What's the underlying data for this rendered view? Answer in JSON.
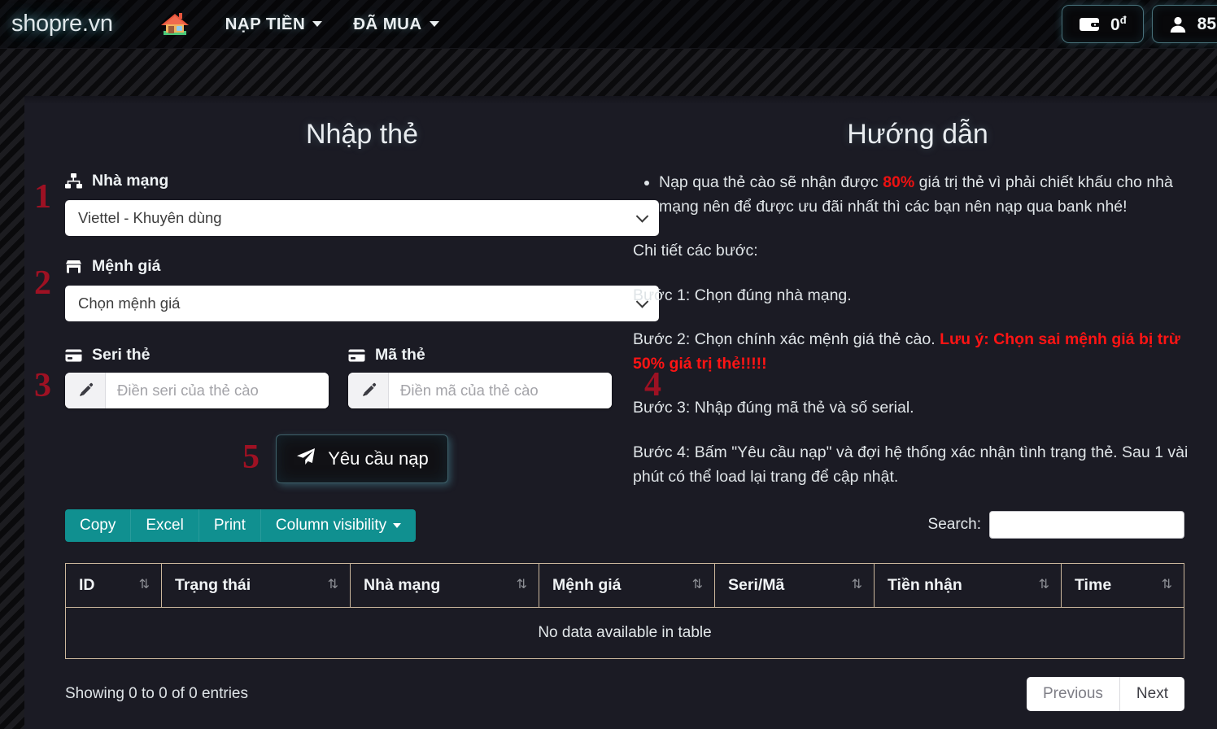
{
  "header": {
    "brand": "shopre.vn",
    "home_icon": "home-icon",
    "nav": [
      {
        "label": "NẠP TIỀN",
        "icon": "chevron-down-icon"
      },
      {
        "label": "ĐÃ MUA",
        "icon": "chevron-down-icon"
      }
    ],
    "wallet": {
      "icon": "wallet-icon",
      "amount": "0",
      "currency": "đ"
    },
    "user": {
      "icon": "user-icon",
      "value": "85"
    }
  },
  "card_form": {
    "title": "Nhập thẻ",
    "network_label": "Nhà mạng",
    "network_icon": "sitemap-icon",
    "network_value": "Viettel - Khuyên dùng",
    "amount_label": "Mệnh giá",
    "amount_icon": "store-icon",
    "amount_value": "Chọn mệnh giá",
    "serial_label": "Seri thẻ",
    "serial_icon": "credit-card-icon",
    "serial_placeholder": "Điền seri của thẻ cào",
    "serial_value": "",
    "code_label": "Mã thẻ",
    "code_icon": "credit-card-icon",
    "code_placeholder": "Điền mã của thẻ cào",
    "code_value": "",
    "input_prefix_icon": "pen-icon",
    "submit_label": "Yêu cầu nạp",
    "submit_icon": "paper-plane-icon",
    "steps": [
      "1",
      "2",
      "3",
      "4",
      "5"
    ]
  },
  "guide": {
    "title": "Hướng dẫn",
    "bullet_pre": "Nạp qua thẻ cào sẽ nhận được ",
    "bullet_highlight": "80%",
    "bullet_post": " giá trị thẻ vì phải chiết khấu cho nhà mạng nên để được ưu đãi nhất thì các bạn nên nạp qua bank nhé!",
    "intro": "Chi tiết các bước:",
    "step1": "Bước 1: Chọn đúng nhà mạng.",
    "step2_pre": "Bước 2: Chọn chính xác mệnh giá thẻ cào. ",
    "step2_warn": "Lưu ý: Chọn sai mệnh giá bị trừ 50% giá trị thẻ!!!!!",
    "step3": "Bước 3: Nhập đúng mã thẻ và số serial.",
    "step4": "Bước 4: Bấm \"Yêu cầu nạp\" và đợi hệ thống xác nhận tình trạng thẻ. Sau 1 vài phút có thể load lại trang để cập nhật."
  },
  "table": {
    "buttons": [
      {
        "label": "Copy"
      },
      {
        "label": "Excel"
      },
      {
        "label": "Print"
      },
      {
        "label": "Column visibility",
        "caret": true
      }
    ],
    "search_label": "Search:",
    "search_value": "",
    "search_placeholder": "",
    "columns": [
      "ID",
      "Trạng thái",
      "Nhà mạng",
      "Mệnh giá",
      "Seri/Mã",
      "Tiền nhận",
      "Time"
    ],
    "sort_glyph": "⇅",
    "empty_text": "No data available in table",
    "info": "Showing 0 to 0 of 0 entries",
    "prev_label": "Previous",
    "next_label": "Next"
  },
  "colors": {
    "panel_bg": "#1b1b24",
    "toolbar_teal": "#109090",
    "step_number_red": "#9e1123",
    "warning_red": "#ff1414",
    "accent_cyan": "#7dc8d7",
    "table_border": "#cbb79c"
  }
}
